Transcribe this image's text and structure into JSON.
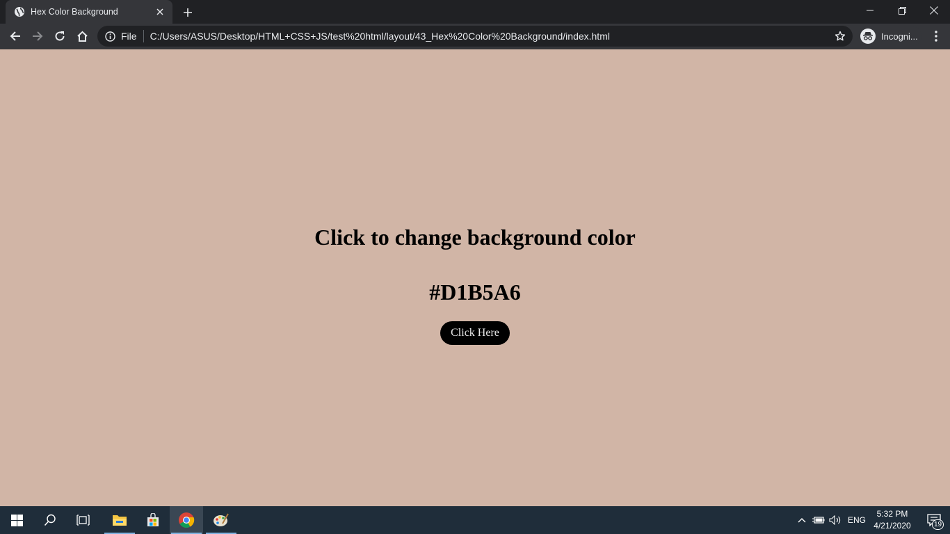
{
  "browser": {
    "tab_title": "Hex Color Background",
    "url_scheme": "File",
    "url": "C:/Users/ASUS/Desktop/HTML+CSS+JS/test%20html/layout/43_Hex%20Color%20Background/index.html",
    "profile_label": "Incogni..."
  },
  "page": {
    "background": "#D1B5A6",
    "heading": "Click to change background color",
    "hex_value": "#D1B5A6",
    "button_label": "Click Here"
  },
  "taskbar": {
    "language": "ENG",
    "time": "5:32 PM",
    "date": "4/21/2020",
    "notification_count": "19",
    "apps": [
      "start",
      "search",
      "task-view",
      "file-explorer",
      "microsoft-store",
      "chrome",
      "paint"
    ]
  },
  "colors": {
    "tab_active": "#35363a",
    "chrome_dark": "#202124",
    "taskbar": "#1f2d3a",
    "button_bg": "#000000"
  }
}
